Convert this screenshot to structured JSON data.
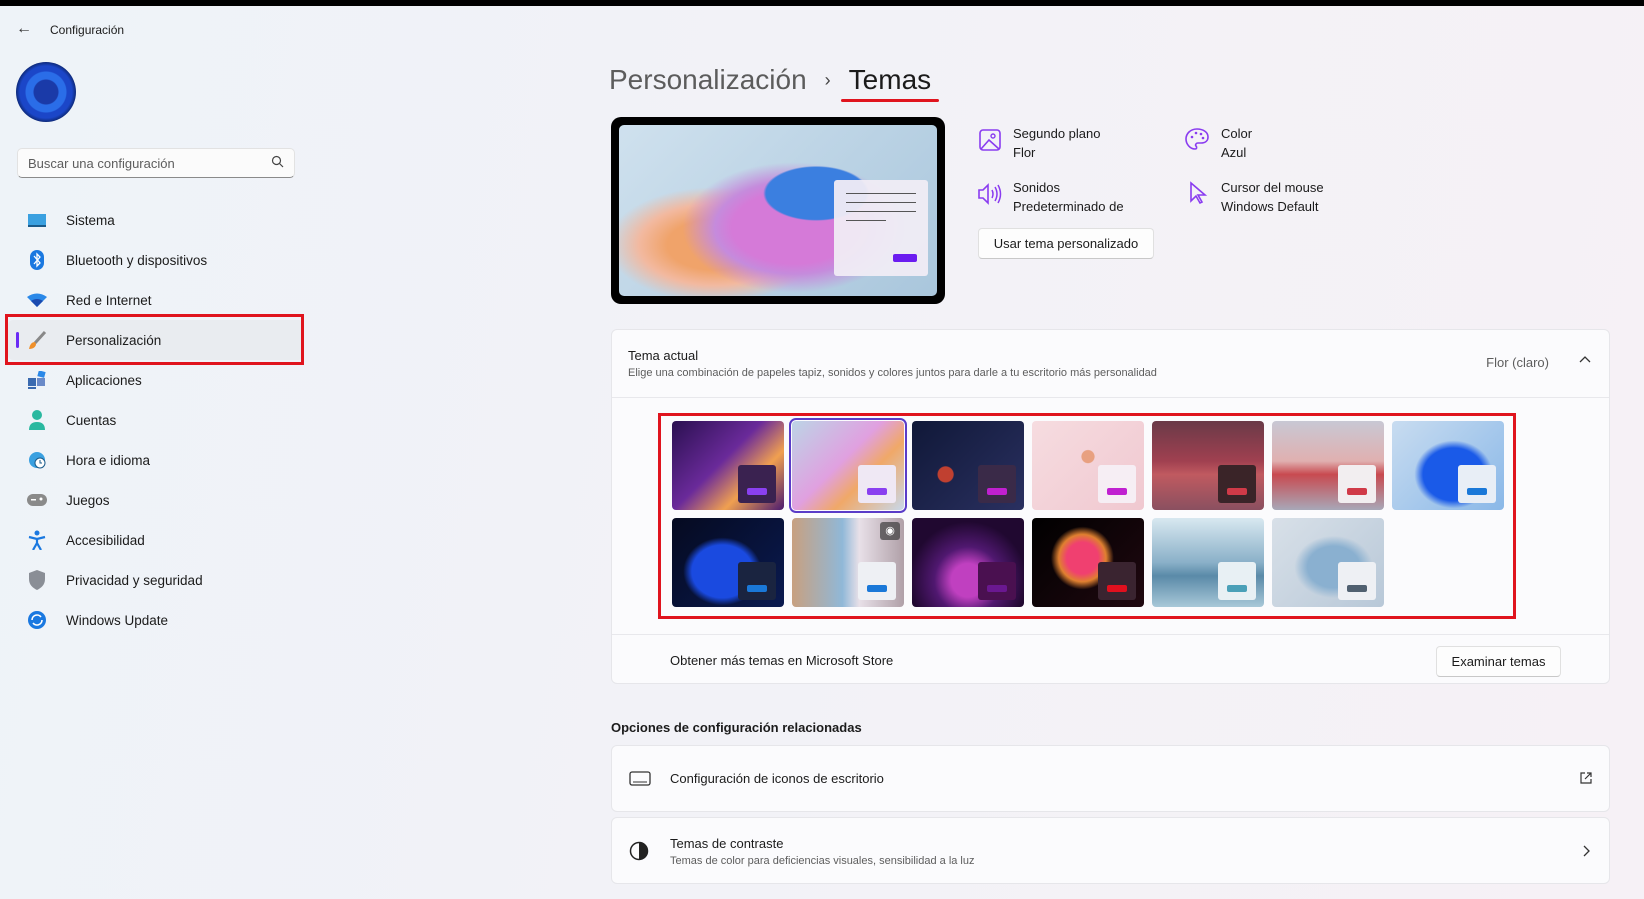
{
  "app": {
    "title": "Configuración",
    "back_icon": "arrow-left-icon"
  },
  "search": {
    "placeholder": "Buscar una configuración",
    "icon": "search-icon"
  },
  "sidebar": {
    "items": [
      {
        "label": "Sistema",
        "icon": "monitor-icon"
      },
      {
        "label": "Bluetooth y dispositivos",
        "icon": "bluetooth-icon"
      },
      {
        "label": "Red e Internet",
        "icon": "wifi-icon"
      },
      {
        "label": "Personalización",
        "icon": "brush-icon",
        "selected": true
      },
      {
        "label": "Aplicaciones",
        "icon": "apps-icon"
      },
      {
        "label": "Cuentas",
        "icon": "person-icon"
      },
      {
        "label": "Hora e idioma",
        "icon": "clock-globe-icon"
      },
      {
        "label": "Juegos",
        "icon": "gamepad-icon"
      },
      {
        "label": "Accesibilidad",
        "icon": "accessibility-icon"
      },
      {
        "label": "Privacidad y seguridad",
        "icon": "shield-icon"
      },
      {
        "label": "Windows Update",
        "icon": "update-icon"
      }
    ]
  },
  "breadcrumb": {
    "parent": "Personalización",
    "separator": "›",
    "current": "Temas"
  },
  "theme_info": {
    "background": {
      "label": "Segundo plano",
      "value": "Flor"
    },
    "color": {
      "label": "Color",
      "value": "Azul"
    },
    "sounds": {
      "label": "Sonidos",
      "value": "Predeterminado de"
    },
    "cursor": {
      "label": "Cursor del mouse",
      "value": "Windows Default"
    },
    "custom_button": "Usar tema personalizado"
  },
  "current_theme": {
    "title": "Tema actual",
    "description": "Elige una combinación de papeles tapiz, sonidos y colores juntos para darle a tu escritorio más personalidad",
    "value": "Flor (claro)"
  },
  "themes": [
    {
      "bg": "linear-gradient(135deg,#2a1050,#6a2a9a 45%,#f0a050 70%,#4a1a70)",
      "mini": "#3a2250",
      "bar": "#8a40f0"
    },
    {
      "bg": "linear-gradient(135deg,#bcd4e6,#e0a0e0 45%,#f0a868 65%,#c8d8ea)",
      "mini": "#efe8f4",
      "bar": "#8a40f0",
      "selected": true
    },
    {
      "bg": "radial-gradient(circle at 30% 60%,#c04030 0 8%,transparent 9%),linear-gradient(135deg,#101838,#2a3060)",
      "mini": "#3a2a48",
      "bar": "#c020d0"
    },
    {
      "bg": "radial-gradient(circle at 50% 40%,#e8a080 0 8%,transparent 9%),linear-gradient(135deg,#f6dce0,#f0c8d0)",
      "mini": "#f6eef4",
      "bar": "#c020d0"
    },
    {
      "bg": "linear-gradient(180deg,#6a3a48 0%,#a04050 45%,#c05a60 60%,#8a5060)",
      "mini": "#3a2428",
      "bar": "#d03a48"
    },
    {
      "bg": "linear-gradient(180deg,#c8c8d4 0%,#e0b0b0 45%,#c84a50 60%,#a8a8b8)",
      "mini": "#f2eef0",
      "bar": "#d03a48"
    },
    {
      "bg": "radial-gradient(ellipse at 55% 60%,#1a5ae8 0 35%,transparent 45%),linear-gradient(135deg,#c8dcf0,#8ab8e8)",
      "mini": "#e8eef6",
      "bar": "#1a78d8"
    },
    {
      "bg": "radial-gradient(ellipse at 45% 60%,#1a4ae0 0 35%,transparent 45%),linear-gradient(135deg,#050a20,#0a1a50)",
      "mini": "#1a2440",
      "bar": "#1a78d8"
    },
    {
      "bg": "linear-gradient(90deg,#c8a080 0%,#90b8d8 45%,#e8e0e8 60%,#b0a0a8)",
      "mini": "#eef0f4",
      "bar": "#1a78d8",
      "camera": true
    },
    {
      "bg": "radial-gradient(circle at 50% 70%,#c040c0 0 20%,#501870 40%,#200830 70%)",
      "mini": "#4a1050",
      "bar": "#6a1890"
    },
    {
      "bg": "radial-gradient(circle at 45% 45%,#f04070 0 20%,#e08030 30%,transparent 40%),linear-gradient(135deg,#000,#200810)",
      "mini": "#3a2430",
      "bar": "#e0101e"
    },
    {
      "bg": "linear-gradient(180deg,#d8e8f0 0%,#8ab0c8 50%,#5a8aa8 65%,#a8c8d8)",
      "mini": "#e8f0f4",
      "bar": "#4aa0b8"
    },
    {
      "bg": "radial-gradient(ellipse at 55% 55%,#8ab0d0 0 30%,transparent 45%),linear-gradient(135deg,#d8e0e8,#b8c8d8)",
      "mini": "#eef0f4",
      "bar": "#506070"
    }
  ],
  "store": {
    "label": "Obtener más temas en Microsoft Store",
    "button": "Examinar temas"
  },
  "related": {
    "heading": "Opciones de configuración relacionadas",
    "items": [
      {
        "label": "Configuración de iconos de escritorio",
        "icon": "desktop-icon",
        "action_icon": "open-external-icon"
      },
      {
        "label": "Temas de contraste",
        "description": "Temas de color para deficiencias visuales, sensibilidad a la luz",
        "icon": "contrast-icon",
        "action_icon": "chevron-right-icon"
      }
    ]
  },
  "colors": {
    "accent": "#6b2cf5",
    "highlight": "#e0141e"
  }
}
